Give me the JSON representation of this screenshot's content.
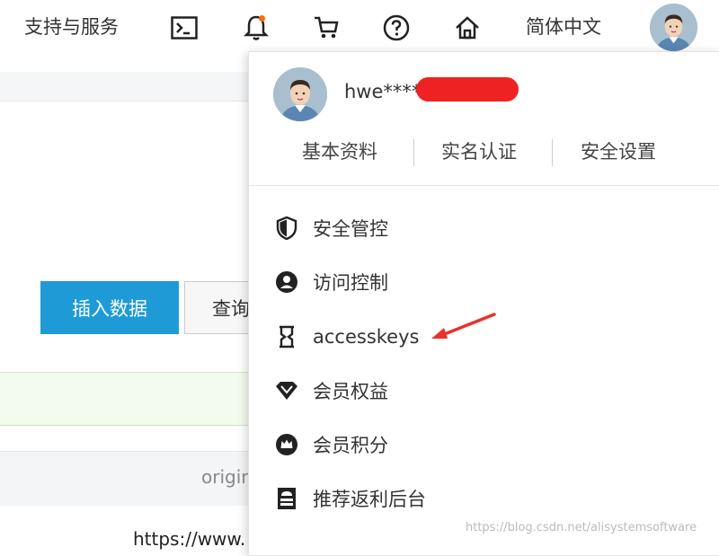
{
  "topbar": {
    "support_label": "支持与服务",
    "icons": [
      "terminal-icon",
      "bell-icon",
      "cart-icon",
      "help-icon",
      "home-icon"
    ],
    "language": "简体中文"
  },
  "page": {
    "insert_button": "插入数据",
    "query_button": "查询",
    "origin_text": "origin",
    "url_text": "https://www."
  },
  "dropdown": {
    "username": "hwe****@",
    "tabs": [
      "基本资料",
      "实名认证",
      "安全设置"
    ],
    "items": [
      {
        "icon": "shield-icon",
        "label": "安全管控"
      },
      {
        "icon": "user-circle-icon",
        "label": "访问控制"
      },
      {
        "icon": "accesskey-icon",
        "label": "accesskeys"
      },
      {
        "icon": "diamond-icon",
        "label": "会员权益"
      },
      {
        "icon": "crown-icon",
        "label": "会员积分"
      },
      {
        "icon": "referral-icon",
        "label": "推荐返利后台"
      }
    ]
  },
  "colors": {
    "accent": "#1e9bd7",
    "redaction": "#ee2222",
    "arrow": "#e8322b",
    "notification_dot": "#ff6a00"
  },
  "watermark": "https://blog.csdn.net/alisystemsoftware"
}
